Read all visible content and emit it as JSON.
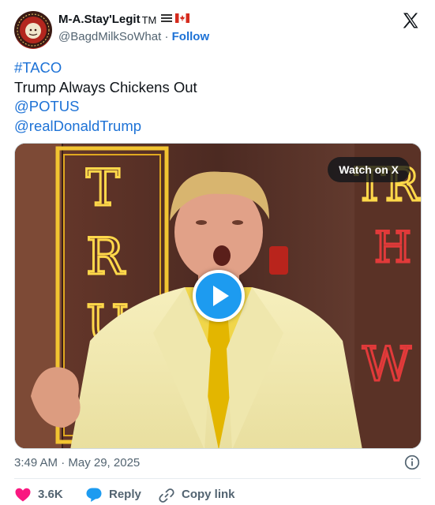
{
  "author": {
    "display_name": "M-A.Stay'Legit",
    "name_badges": "TM",
    "handle": "@BagdMilkSoWhat",
    "separator": "·",
    "follow_label": "Follow",
    "avatar_text": "M-A.STAY'LEGIT"
  },
  "tweet": {
    "lines": [
      "#TACO",
      "Trump Always Chickens Out",
      "@POTUS",
      "@realDonaldTrump"
    ]
  },
  "media": {
    "watch_label": "Watch on X",
    "play_icon": "play-icon"
  },
  "meta": {
    "timestamp": "3:49 AM · May 29, 2025"
  },
  "actions": {
    "likes": "3.6K",
    "reply_label": "Reply",
    "copy_label": "Copy link"
  },
  "colors": {
    "link": "#1d72d6",
    "like": "#f91880",
    "reply": "#1d9bf0",
    "play": "#1d9bf0"
  },
  "icons": [
    "x-logo-icon",
    "info-icon",
    "heart-icon",
    "reply-bubble-icon",
    "link-icon",
    "flag-icon"
  ]
}
